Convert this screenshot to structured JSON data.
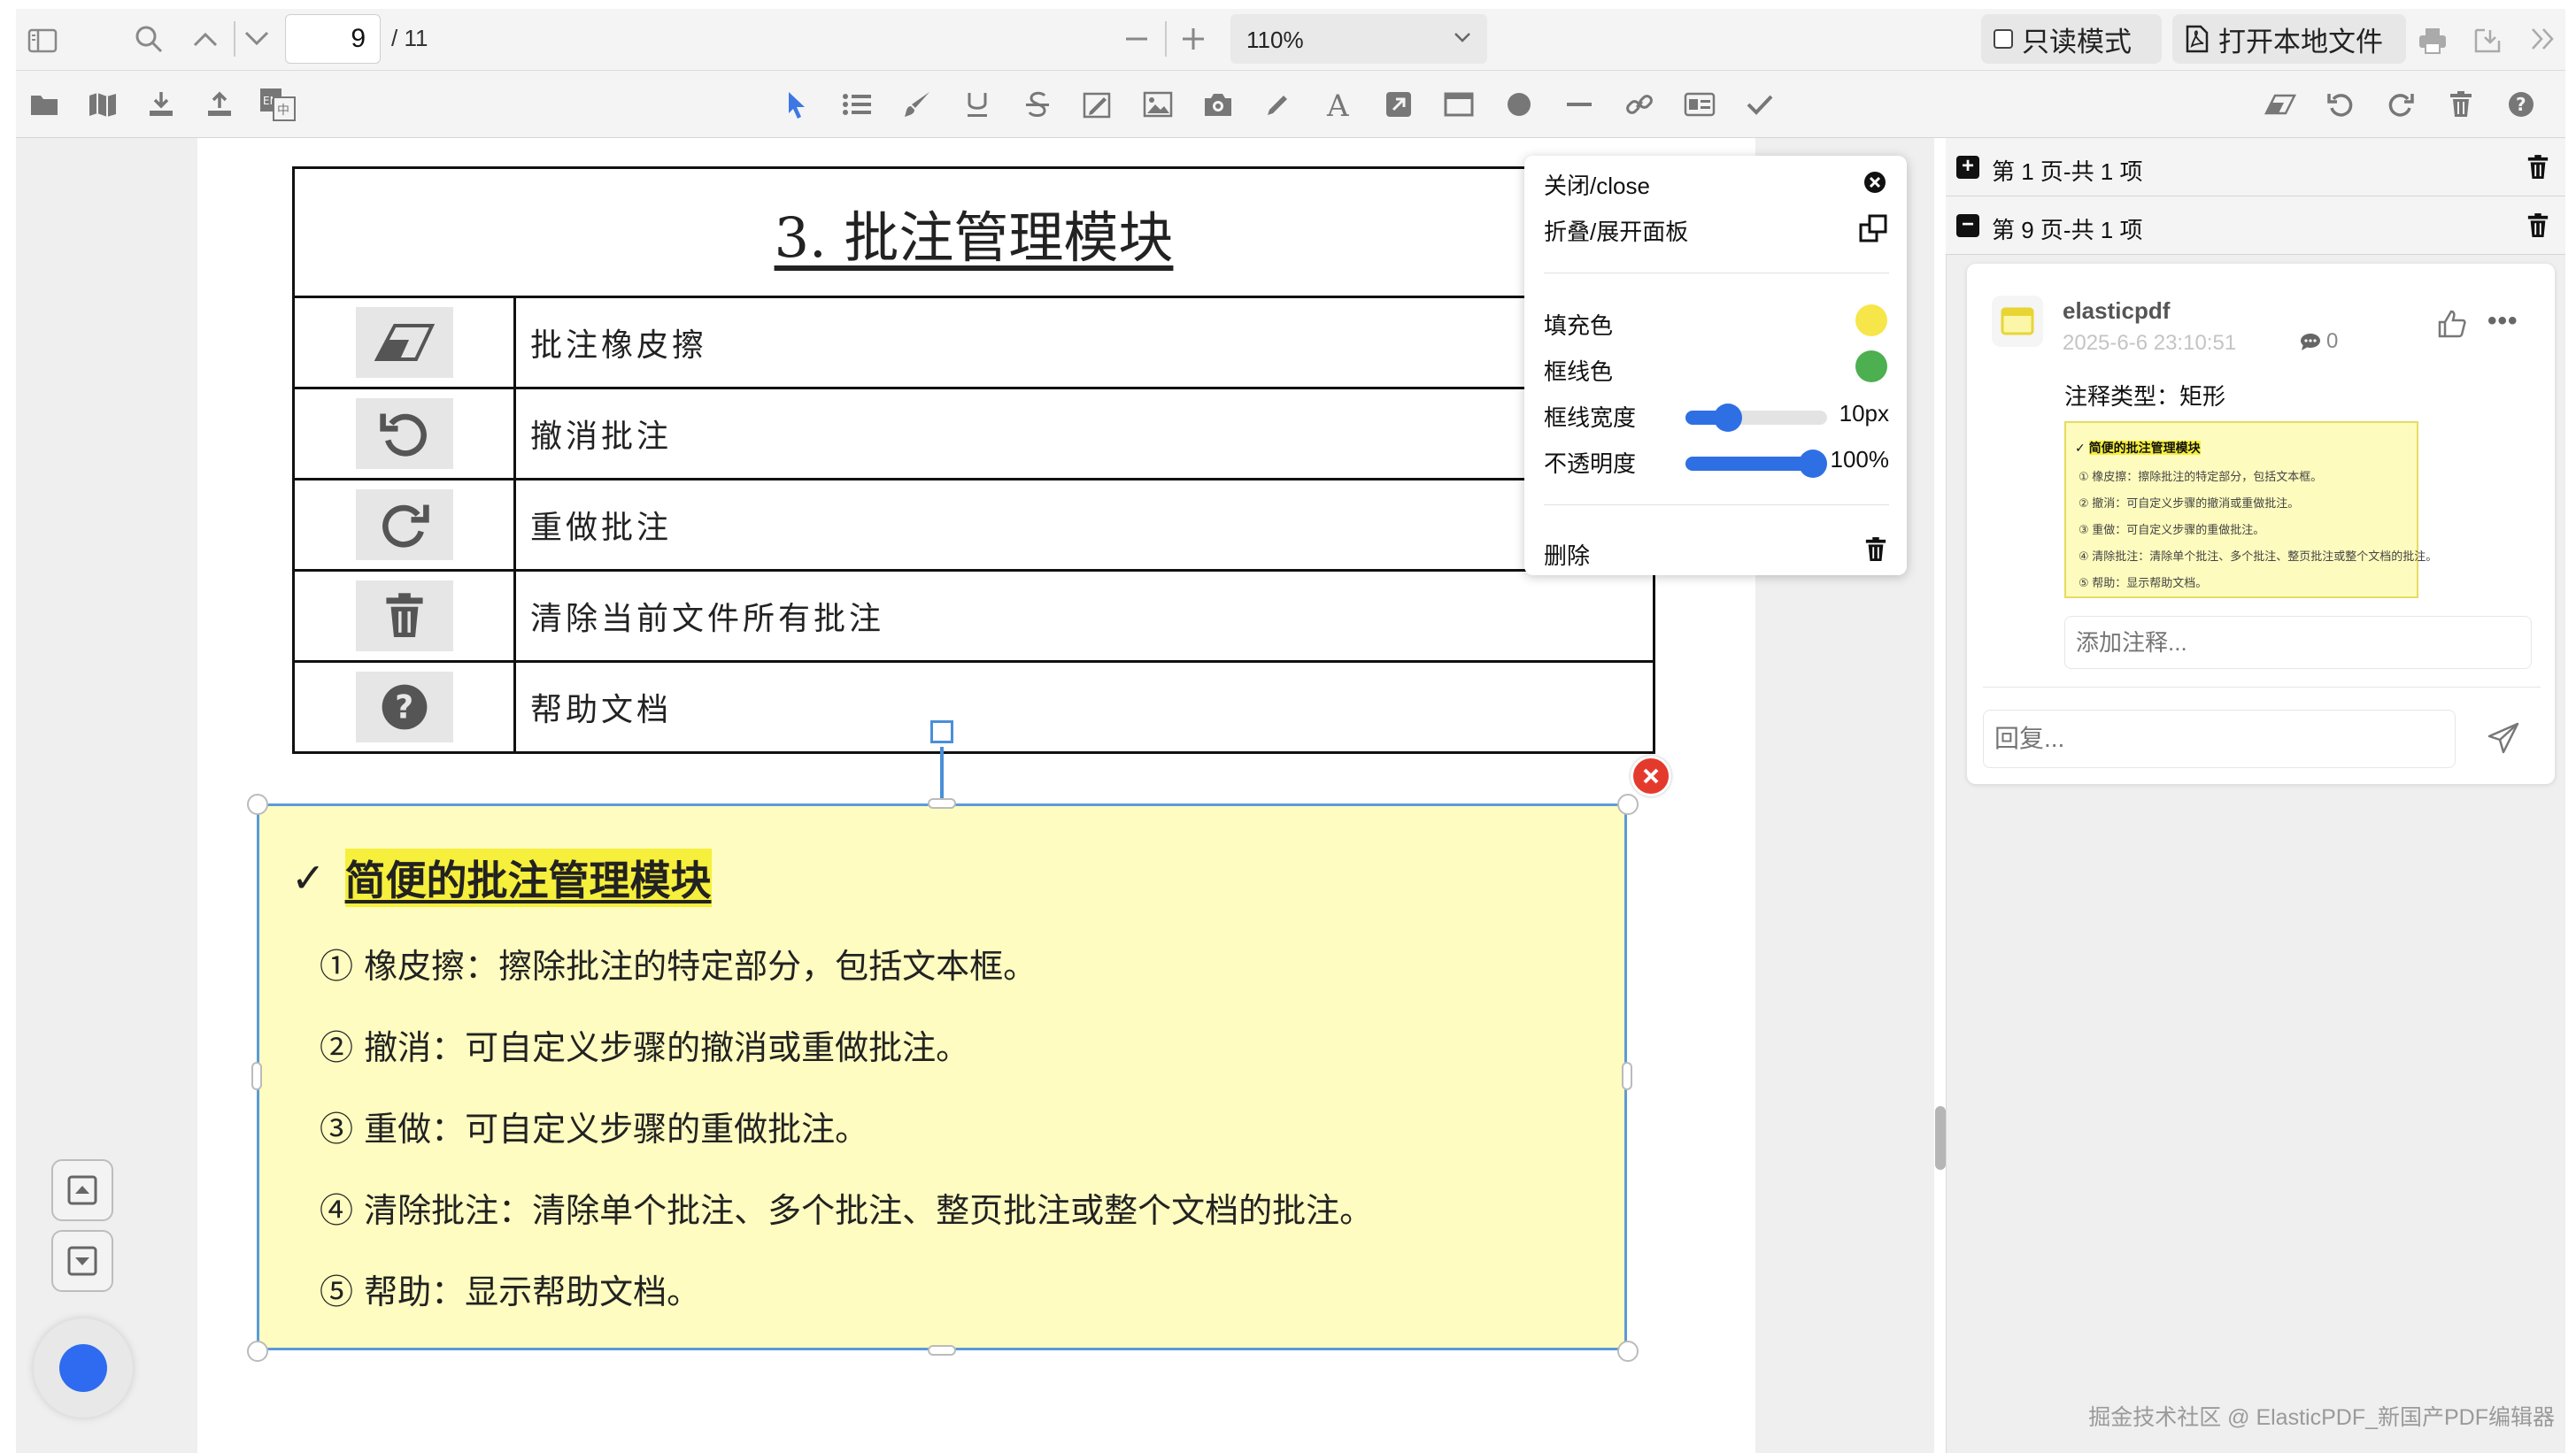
{
  "toolbar": {
    "page_current": "9",
    "page_total": "/ 11",
    "zoom": "110%",
    "readonly_label": "只读模式",
    "open_local_label": "打开本地文件"
  },
  "document": {
    "table_title": "3. 批注管理模块",
    "rows": [
      {
        "icon": "eraser-icon",
        "label": "批注橡皮擦"
      },
      {
        "icon": "undo-icon",
        "label": "撤消批注"
      },
      {
        "icon": "redo-icon",
        "label": "重做批注"
      },
      {
        "icon": "trash-icon",
        "label": "清除当前文件所有批注"
      },
      {
        "icon": "help-icon",
        "label": "帮助文档"
      }
    ]
  },
  "annotation": {
    "check": "✓",
    "title": "简便的批注管理模块",
    "lines": [
      "① 橡皮擦：擦除批注的特定部分，包括文本框。",
      "② 撤消：可自定义步骤的撤消或重做批注。",
      "③ 重做：可自定义步骤的重做批注。",
      "④ 清除批注：清除单个批注、多个批注、整页批注或整个文档的批注。",
      "⑤ 帮助：显示帮助文档。"
    ]
  },
  "popup": {
    "close_label": "关闭/close",
    "fold_label": "折叠/展开面板",
    "fill_label": "填充色",
    "stroke_label": "框线色",
    "stroke_width_label": "框线宽度",
    "stroke_width_value": "10px",
    "stroke_width_level": 0.25,
    "opacity_label": "不透明度",
    "opacity_value": "100%",
    "opacity_level": 1.0,
    "delete_label": "删除",
    "fill_color": "#f7e64a",
    "stroke_color": "#4caf50"
  },
  "panel": {
    "sections": [
      {
        "sign": "+",
        "label": "第 1 页-共 1 项"
      },
      {
        "sign": "−",
        "label": "第 9 页-共 1 项"
      }
    ],
    "card": {
      "user": "elasticpdf",
      "time": "2025-6-6 23:10:51",
      "comment_count": "0",
      "type_label": "注释类型：矩形",
      "thumb_title": "简便的批注管理模块",
      "thumb_lines": [
        "① 橡皮擦：擦除批注的特定部分，包括文本框。",
        "② 撤消：可自定义步骤的撤消或重做批注。",
        "③ 重做：可自定义步骤的重做批注。",
        "④ 清除批注：清除单个批注、多个批注、整页批注或整个文档的批注。",
        "⑤ 帮助：显示帮助文档。"
      ],
      "note_placeholder": "添加注释...",
      "reply_placeholder": "回复..."
    }
  },
  "watermark": "掘金技术社区 @ ElasticPDF_新国产PDF编辑器",
  "colors": {
    "accent": "#2f6fe4",
    "selection": "#5a9bd8",
    "annotation_bg": "#fefcc0",
    "highlight": "#f6ef3c",
    "delete_red": "#e43a2e"
  }
}
